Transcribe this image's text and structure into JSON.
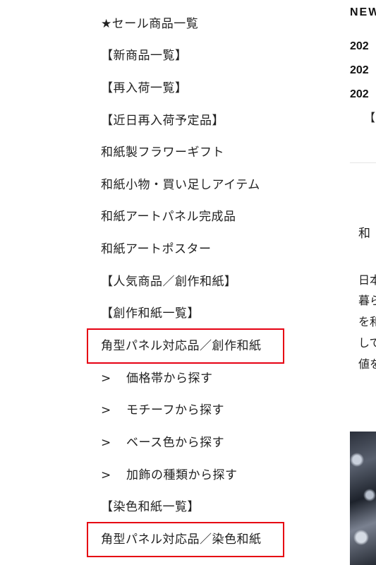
{
  "menu": {
    "items": [
      {
        "label": "★セール商品一覧"
      },
      {
        "label": "【新商品一覧】"
      },
      {
        "label": "【再入荷一覧】"
      },
      {
        "label": "【近日再入荷予定品】"
      },
      {
        "label": "和紙製フラワーギフト"
      },
      {
        "label": "和紙小物・買い足しアイテム"
      },
      {
        "label": "和紙アートパネル完成品"
      },
      {
        "label": "和紙アートポスター"
      },
      {
        "label": "【人気商品／創作和紙】"
      },
      {
        "label": "【創作和紙一覧】"
      },
      {
        "label": "角型パネル対応品／創作和紙"
      },
      {
        "arrow": ">",
        "label": "価格帯から探す"
      },
      {
        "arrow": ">",
        "label": "モチーフから探す"
      },
      {
        "arrow": ">",
        "label": "ベース色から探す"
      },
      {
        "arrow": ">",
        "label": "加飾の種類から探す"
      },
      {
        "label": "【染色和紙一覧】"
      },
      {
        "label": "角型パネル対応品／染色和紙"
      }
    ]
  },
  "right": {
    "news_title": "NEW",
    "dates": [
      "202",
      "202",
      "202"
    ],
    "news_sub": "【",
    "section_text": "和",
    "paragraph": [
      "日本",
      "暮ら",
      "を和",
      "して",
      "値を"
    ]
  }
}
